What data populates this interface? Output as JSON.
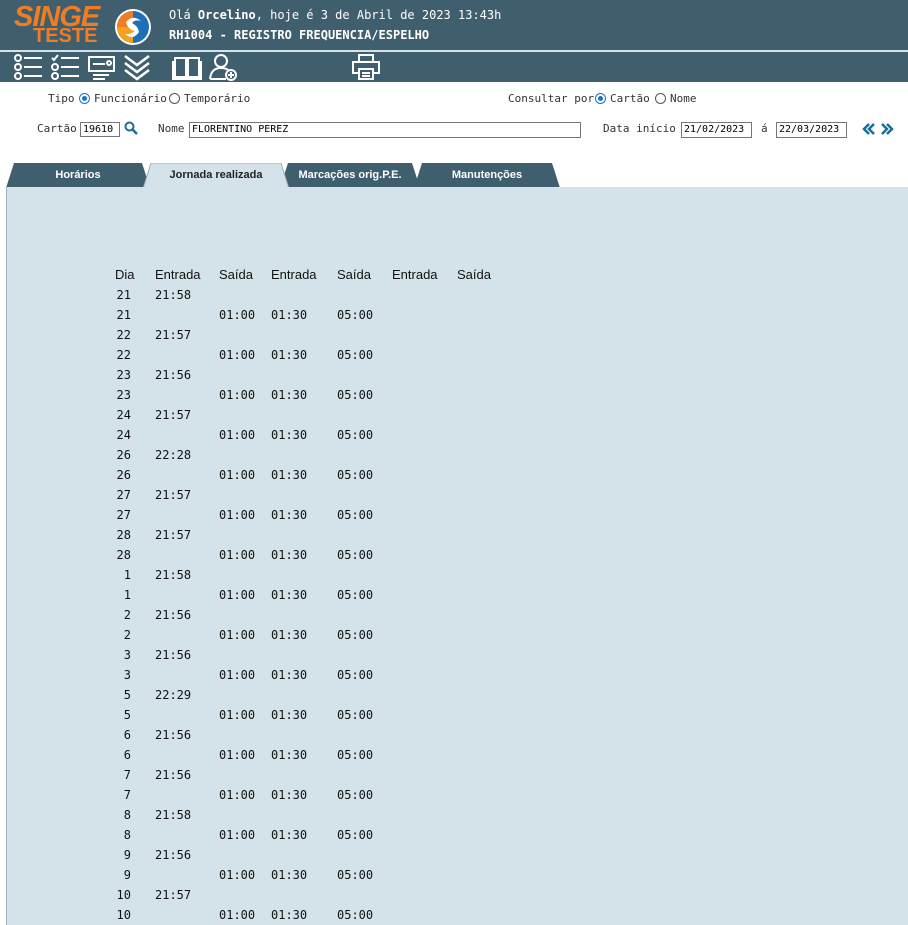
{
  "header": {
    "logo_text": "SINGE",
    "logo_sub": "TESTE",
    "greeting_prefix": "Olá ",
    "user_name": "Orcelino",
    "greeting_suffix": ", hoje é 3 de Abril de 2023 13:43h",
    "screen_title": "RH1004 - REGISTRO FREQUENCIA/ESPELHO"
  },
  "toolbar": {
    "icons": [
      "list-icon",
      "checklist-icon",
      "card-icon",
      "double-chevron-down-icon",
      "book-icon",
      "add-user-icon",
      "printer-icon"
    ]
  },
  "form": {
    "tipo_label": "Tipo",
    "tipo_options": [
      "Funcionário",
      "Temporário"
    ],
    "tipo_selected": "Funcionário",
    "consultar_label": "Consultar por",
    "consultar_options": [
      "Cartão",
      "Nome"
    ],
    "consultar_selected": "Cartão",
    "cartao_label": "Cartão",
    "cartao_value": "19610",
    "nome_label": "Nome",
    "nome_value": "FLORENTINO PEREZ",
    "data_inicio_label": "Data início",
    "data_inicio_value": "21/02/2023",
    "ate_label": "á",
    "data_fim_value": "22/03/2023"
  },
  "tabs": [
    "Horários",
    "Jornada realizada",
    "Marcações orig.P.E.",
    "Manutenções"
  ],
  "active_tab": "Jornada realizada",
  "grid": {
    "columns": [
      "Dia",
      "Entrada",
      "Saída",
      "Entrada",
      "Saída",
      "Entrada",
      "Saída"
    ],
    "rows": [
      {
        "dia": "21",
        "entrada1": "21:58",
        "saida1": "",
        "entrada2": "",
        "saida2": ""
      },
      {
        "dia": "21",
        "entrada1": "",
        "saida1": "01:00",
        "entrada2": "01:30",
        "saida2": "05:00"
      },
      {
        "dia": "22",
        "entrada1": "21:57",
        "saida1": "",
        "entrada2": "",
        "saida2": ""
      },
      {
        "dia": "22",
        "entrada1": "",
        "saida1": "01:00",
        "entrada2": "01:30",
        "saida2": "05:00"
      },
      {
        "dia": "23",
        "entrada1": "21:56",
        "saida1": "",
        "entrada2": "",
        "saida2": ""
      },
      {
        "dia": "23",
        "entrada1": "",
        "saida1": "01:00",
        "entrada2": "01:30",
        "saida2": "05:00"
      },
      {
        "dia": "24",
        "entrada1": "21:57",
        "saida1": "",
        "entrada2": "",
        "saida2": ""
      },
      {
        "dia": "24",
        "entrada1": "",
        "saida1": "01:00",
        "entrada2": "01:30",
        "saida2": "05:00"
      },
      {
        "dia": "26",
        "entrada1": "22:28",
        "saida1": "",
        "entrada2": "",
        "saida2": ""
      },
      {
        "dia": "26",
        "entrada1": "",
        "saida1": "01:00",
        "entrada2": "01:30",
        "saida2": "05:00"
      },
      {
        "dia": "27",
        "entrada1": "21:57",
        "saida1": "",
        "entrada2": "",
        "saida2": ""
      },
      {
        "dia": "27",
        "entrada1": "",
        "saida1": "01:00",
        "entrada2": "01:30",
        "saida2": "05:00"
      },
      {
        "dia": "28",
        "entrada1": "21:57",
        "saida1": "",
        "entrada2": "",
        "saida2": ""
      },
      {
        "dia": "28",
        "entrada1": "",
        "saida1": "01:00",
        "entrada2": "01:30",
        "saida2": "05:00"
      },
      {
        "dia": "1",
        "entrada1": "21:58",
        "saida1": "",
        "entrada2": "",
        "saida2": ""
      },
      {
        "dia": "1",
        "entrada1": "",
        "saida1": "01:00",
        "entrada2": "01:30",
        "saida2": "05:00"
      },
      {
        "dia": "2",
        "entrada1": "21:56",
        "saida1": "",
        "entrada2": "",
        "saida2": ""
      },
      {
        "dia": "2",
        "entrada1": "",
        "saida1": "01:00",
        "entrada2": "01:30",
        "saida2": "05:00"
      },
      {
        "dia": "3",
        "entrada1": "21:56",
        "saida1": "",
        "entrada2": "",
        "saida2": ""
      },
      {
        "dia": "3",
        "entrada1": "",
        "saida1": "01:00",
        "entrada2": "01:30",
        "saida2": "05:00"
      },
      {
        "dia": "5",
        "entrada1": "22:29",
        "saida1": "",
        "entrada2": "",
        "saida2": ""
      },
      {
        "dia": "5",
        "entrada1": "",
        "saida1": "01:00",
        "entrada2": "01:30",
        "saida2": "05:00"
      },
      {
        "dia": "6",
        "entrada1": "21:56",
        "saida1": "",
        "entrada2": "",
        "saida2": ""
      },
      {
        "dia": "6",
        "entrada1": "",
        "saida1": "01:00",
        "entrada2": "01:30",
        "saida2": "05:00"
      },
      {
        "dia": "7",
        "entrada1": "21:56",
        "saida1": "",
        "entrada2": "",
        "saida2": ""
      },
      {
        "dia": "7",
        "entrada1": "",
        "saida1": "01:00",
        "entrada2": "01:30",
        "saida2": "05:00"
      },
      {
        "dia": "8",
        "entrada1": "21:58",
        "saida1": "",
        "entrada2": "",
        "saida2": ""
      },
      {
        "dia": "8",
        "entrada1": "",
        "saida1": "01:00",
        "entrada2": "01:30",
        "saida2": "05:00"
      },
      {
        "dia": "9",
        "entrada1": "21:56",
        "saida1": "",
        "entrada2": "",
        "saida2": ""
      },
      {
        "dia": "9",
        "entrada1": "",
        "saida1": "01:00",
        "entrada2": "01:30",
        "saida2": "05:00"
      },
      {
        "dia": "10",
        "entrada1": "21:57",
        "saida1": "",
        "entrada2": "",
        "saida2": ""
      },
      {
        "dia": "10",
        "entrada1": "",
        "saida1": "01:00",
        "entrada2": "01:30",
        "saida2": "05:00"
      }
    ]
  },
  "colors": {
    "header_bg": "#3f5f6f",
    "logo_orange": "#f07d22",
    "panel_bg": "#d4e3e9",
    "radio_blue": "#1a73c9",
    "nav_arrow": "#1a6f95"
  }
}
